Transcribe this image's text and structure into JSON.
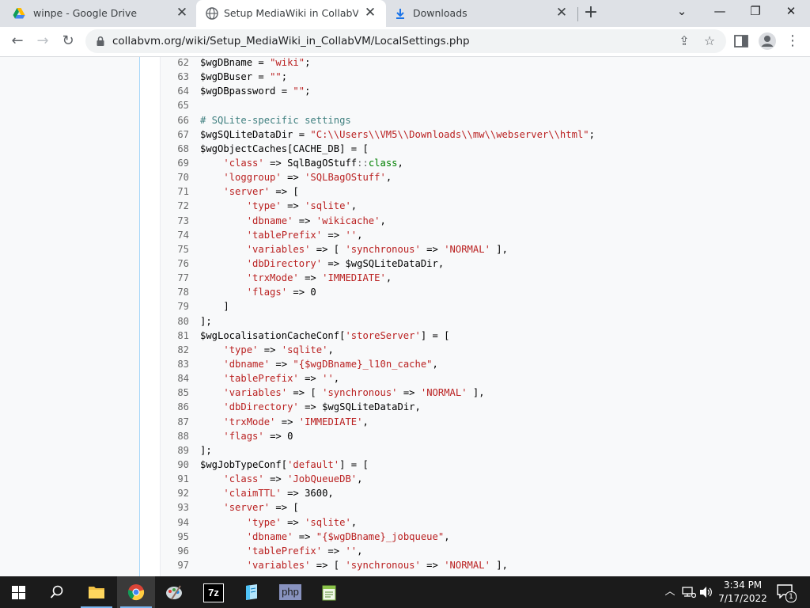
{
  "tabs": [
    {
      "title": "winpe - Google Drive",
      "icon": "google-drive-icon"
    },
    {
      "title": "Setup MediaWiki in CollabVM/Lo",
      "icon": "globe-icon"
    },
    {
      "title": "Downloads",
      "icon": "download-icon"
    }
  ],
  "toolbar": {
    "url": "collabvm.org/wiki/Setup_MediaWiki_in_CollabVM/LocalSettings.php"
  },
  "code_lines": [
    {
      "n": "62",
      "parts": [
        [
          "t",
          "$wgDBname = "
        ],
        [
          "s",
          "\"wiki\""
        ],
        [
          "t",
          ";"
        ]
      ]
    },
    {
      "n": "63",
      "parts": [
        [
          "t",
          "$wgDBuser = "
        ],
        [
          "s",
          "\"\""
        ],
        [
          "t",
          ";"
        ]
      ]
    },
    {
      "n": "64",
      "parts": [
        [
          "t",
          "$wgDBpassword = "
        ],
        [
          "s",
          "\"\""
        ],
        [
          "t",
          ";"
        ]
      ]
    },
    {
      "n": "65",
      "parts": []
    },
    {
      "n": "66",
      "parts": [
        [
          "t",
          "# SQLite-specific settings"
        ]
      ]
    },
    {
      "n": "67",
      "parts": [
        [
          "t",
          "$wgSQLiteDataDir = "
        ],
        [
          "s",
          "\"C:\\\\Users\\\\VM5\\\\Downloads\\\\mw\\\\webserver\\\\html\""
        ],
        [
          "t",
          ";"
        ]
      ]
    },
    {
      "n": "68",
      "parts": [
        [
          "t",
          "$wgObjectCaches[CACHE_DB] = ["
        ]
      ]
    },
    {
      "n": "69",
      "parts": [
        [
          "t",
          "    "
        ],
        [
          "s",
          "'class'"
        ],
        [
          "t",
          " => SqlBagOStuff"
        ],
        [
          "o",
          "::"
        ],
        [
          "k",
          "class"
        ],
        [
          "t",
          ","
        ]
      ]
    },
    {
      "n": "70",
      "parts": [
        [
          "t",
          "    "
        ],
        [
          "s",
          "'loggroup'"
        ],
        [
          "t",
          " => "
        ],
        [
          "s",
          "'SQLBagOStuff'"
        ],
        [
          "t",
          ","
        ]
      ]
    },
    {
      "n": "71",
      "parts": [
        [
          "t",
          "    "
        ],
        [
          "s",
          "'server'"
        ],
        [
          "t",
          " => ["
        ]
      ]
    },
    {
      "n": "72",
      "parts": [
        [
          "t",
          "        "
        ],
        [
          "s",
          "'type'"
        ],
        [
          "t",
          " => "
        ],
        [
          "s",
          "'sqlite'"
        ],
        [
          "t",
          ","
        ]
      ]
    },
    {
      "n": "73",
      "parts": [
        [
          "t",
          "        "
        ],
        [
          "s",
          "'dbname'"
        ],
        [
          "t",
          " => "
        ],
        [
          "s",
          "'wikicache'"
        ],
        [
          "t",
          ","
        ]
      ]
    },
    {
      "n": "74",
      "parts": [
        [
          "t",
          "        "
        ],
        [
          "s",
          "'tablePrefix'"
        ],
        [
          "t",
          " => "
        ],
        [
          "s",
          "''"
        ],
        [
          "t",
          ","
        ]
      ]
    },
    {
      "n": "75",
      "parts": [
        [
          "t",
          "        "
        ],
        [
          "s",
          "'variables'"
        ],
        [
          "t",
          " => [ "
        ],
        [
          "s",
          "'synchronous'"
        ],
        [
          "t",
          " => "
        ],
        [
          "s",
          "'NORMAL'"
        ],
        [
          "t",
          " ],"
        ]
      ]
    },
    {
      "n": "76",
      "parts": [
        [
          "t",
          "        "
        ],
        [
          "s",
          "'dbDirectory'"
        ],
        [
          "t",
          " => $wgSQLiteDataDir,"
        ]
      ]
    },
    {
      "n": "77",
      "parts": [
        [
          "t",
          "        "
        ],
        [
          "s",
          "'trxMode'"
        ],
        [
          "t",
          " => "
        ],
        [
          "s",
          "'IMMEDIATE'"
        ],
        [
          "t",
          ","
        ]
      ]
    },
    {
      "n": "78",
      "parts": [
        [
          "t",
          "        "
        ],
        [
          "s",
          "'flags'"
        ],
        [
          "t",
          " => 0"
        ]
      ]
    },
    {
      "n": "79",
      "parts": [
        [
          "t",
          "    ]"
        ]
      ]
    },
    {
      "n": "80",
      "parts": [
        [
          "t",
          "];"
        ]
      ]
    },
    {
      "n": "81",
      "parts": [
        [
          "t",
          "$wgLocalisationCacheConf["
        ],
        [
          "s",
          "'storeServer'"
        ],
        [
          "t",
          "] = ["
        ]
      ]
    },
    {
      "n": "82",
      "parts": [
        [
          "t",
          "    "
        ],
        [
          "s",
          "'type'"
        ],
        [
          "t",
          " => "
        ],
        [
          "s",
          "'sqlite'"
        ],
        [
          "t",
          ","
        ]
      ]
    },
    {
      "n": "83",
      "parts": [
        [
          "t",
          "    "
        ],
        [
          "s",
          "'dbname'"
        ],
        [
          "t",
          " => "
        ],
        [
          "s",
          "\"{$wgDBname}_l10n_cache\""
        ],
        [
          "t",
          ","
        ]
      ]
    },
    {
      "n": "84",
      "parts": [
        [
          "t",
          "    "
        ],
        [
          "s",
          "'tablePrefix'"
        ],
        [
          "t",
          " => "
        ],
        [
          "s",
          "''"
        ],
        [
          "t",
          ","
        ]
      ]
    },
    {
      "n": "85",
      "parts": [
        [
          "t",
          "    "
        ],
        [
          "s",
          "'variables'"
        ],
        [
          "t",
          " => [ "
        ],
        [
          "s",
          "'synchronous'"
        ],
        [
          "t",
          " => "
        ],
        [
          "s",
          "'NORMAL'"
        ],
        [
          "t",
          " ],"
        ]
      ]
    },
    {
      "n": "86",
      "parts": [
        [
          "t",
          "    "
        ],
        [
          "s",
          "'dbDirectory'"
        ],
        [
          "t",
          " => $wgSQLiteDataDir,"
        ]
      ]
    },
    {
      "n": "87",
      "parts": [
        [
          "t",
          "    "
        ],
        [
          "s",
          "'trxMode'"
        ],
        [
          "t",
          " => "
        ],
        [
          "s",
          "'IMMEDIATE'"
        ],
        [
          "t",
          ","
        ]
      ]
    },
    {
      "n": "88",
      "parts": [
        [
          "t",
          "    "
        ],
        [
          "s",
          "'flags'"
        ],
        [
          "t",
          " => 0"
        ]
      ]
    },
    {
      "n": "89",
      "parts": [
        [
          "t",
          "];"
        ]
      ]
    },
    {
      "n": "90",
      "parts": [
        [
          "t",
          "$wgJobTypeConf["
        ],
        [
          "s",
          "'default'"
        ],
        [
          "t",
          "] = ["
        ]
      ]
    },
    {
      "n": "91",
      "parts": [
        [
          "t",
          "    "
        ],
        [
          "s",
          "'class'"
        ],
        [
          "t",
          " => "
        ],
        [
          "s",
          "'JobQueueDB'"
        ],
        [
          "t",
          ","
        ]
      ]
    },
    {
      "n": "92",
      "parts": [
        [
          "t",
          "    "
        ],
        [
          "s",
          "'claimTTL'"
        ],
        [
          "t",
          " => 3600,"
        ]
      ]
    },
    {
      "n": "93",
      "parts": [
        [
          "t",
          "    "
        ],
        [
          "s",
          "'server'"
        ],
        [
          "t",
          " => ["
        ]
      ]
    },
    {
      "n": "94",
      "parts": [
        [
          "t",
          "        "
        ],
        [
          "s",
          "'type'"
        ],
        [
          "t",
          " => "
        ],
        [
          "s",
          "'sqlite'"
        ],
        [
          "t",
          ","
        ]
      ]
    },
    {
      "n": "95",
      "parts": [
        [
          "t",
          "        "
        ],
        [
          "s",
          "'dbname'"
        ],
        [
          "t",
          " => "
        ],
        [
          "s",
          "\"{$wgDBname}_jobqueue\""
        ],
        [
          "t",
          ","
        ]
      ]
    },
    {
      "n": "96",
      "parts": [
        [
          "t",
          "        "
        ],
        [
          "s",
          "'tablePrefix'"
        ],
        [
          "t",
          " => "
        ],
        [
          "s",
          "''"
        ],
        [
          "t",
          ","
        ]
      ]
    },
    {
      "n": "97",
      "parts": [
        [
          "t",
          "        "
        ],
        [
          "s",
          "'variables'"
        ],
        [
          "t",
          " => [ "
        ],
        [
          "s",
          "'synchronous'"
        ],
        [
          "t",
          " => "
        ],
        [
          "s",
          "'NORMAL'"
        ],
        [
          "t",
          " ],"
        ]
      ]
    }
  ],
  "taskbar": {
    "apps": [
      {
        "name": "file-explorer-icon"
      },
      {
        "name": "chrome-icon"
      },
      {
        "name": "paint-icon"
      },
      {
        "name": "7zip-icon",
        "label": "7z"
      },
      {
        "name": "notepad-icon"
      },
      {
        "name": "php-icon",
        "label": "php"
      },
      {
        "name": "notepadpp-icon"
      }
    ],
    "time": "3:34 PM",
    "date": "7/17/2022",
    "notification_count": "1"
  }
}
